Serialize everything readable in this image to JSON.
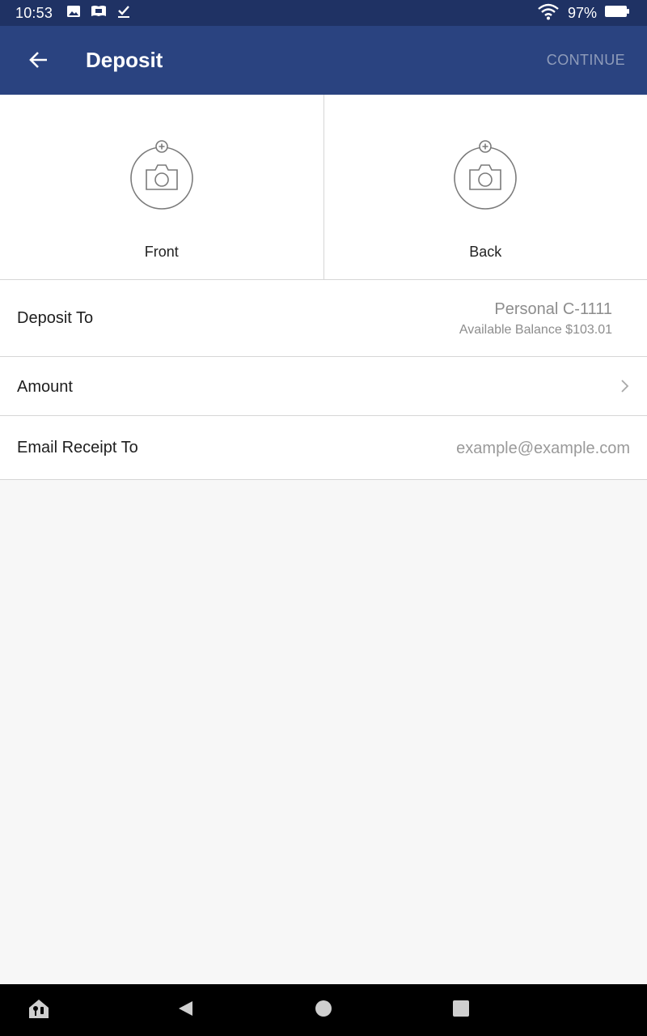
{
  "status_bar": {
    "time": "10:53",
    "battery": "97%",
    "left_icons": [
      "image-icon",
      "book-icon",
      "check-icon"
    ],
    "right_icons": [
      "wifi-icon",
      "battery-icon"
    ]
  },
  "app_bar": {
    "title": "Deposit",
    "back_icon": "arrow-left-icon",
    "continue_label": "CONTINUE",
    "continue_enabled": false
  },
  "photos": [
    {
      "label": "Front",
      "icon": "add-camera-icon"
    },
    {
      "label": "Back",
      "icon": "add-camera-icon"
    }
  ],
  "form": {
    "deposit_to": {
      "label": "Deposit To",
      "account": "Personal C-1111",
      "balance": "Available Balance $103.01"
    },
    "amount": {
      "label": "Amount",
      "icon": "chevron-right-icon"
    },
    "email": {
      "label": "Email Receipt To",
      "value": "",
      "placeholder": "example@example.com"
    }
  },
  "nav_bar": {
    "items": [
      "home-key-icon",
      "back-triangle-icon",
      "home-circle-icon",
      "recents-square-icon"
    ]
  },
  "colors": {
    "status_bar": "#1f3264",
    "app_bar": "#2a4380",
    "continue_disabled": "#8f9cba",
    "background": "#f7f7f7",
    "secondary_text": "#8d8d8d"
  }
}
